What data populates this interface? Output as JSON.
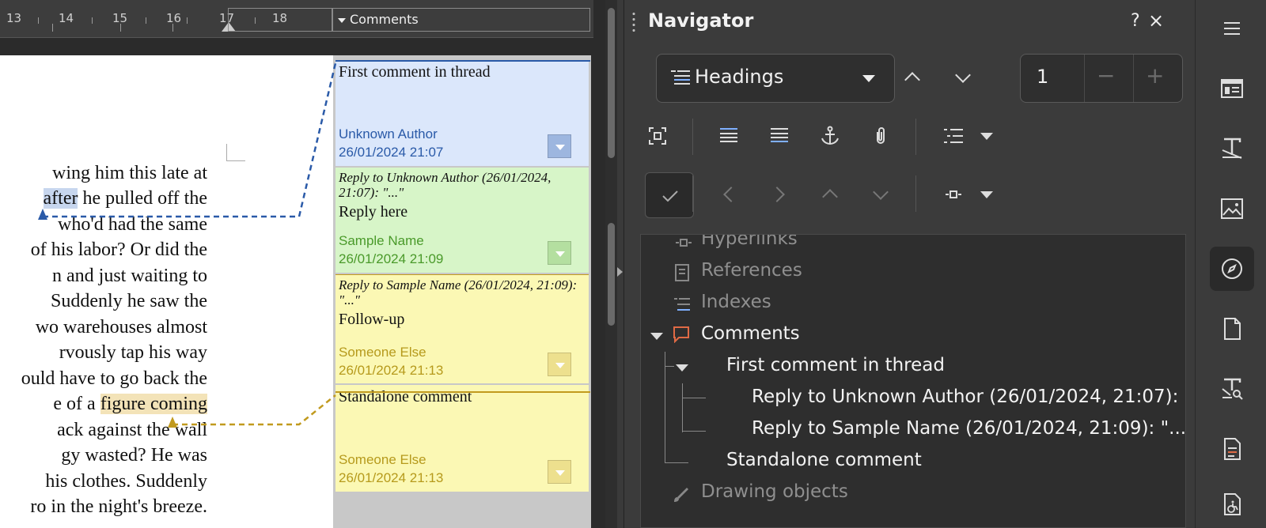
{
  "ruler": {
    "numbers": [
      "13",
      "14",
      "15",
      "16",
      "17",
      "18"
    ],
    "comments_label": "Comments"
  },
  "document": {
    "lines": [
      {
        "pre": "wing him this late at",
        "hl": "",
        "post": ""
      },
      {
        "pre": "",
        "hl": "after",
        "post": " he pulled off the",
        "hl_color": "blue"
      },
      {
        "pre": "who'd had the same",
        "hl": "",
        "post": ""
      },
      {
        "pre": "of his labor? Or did the",
        "hl": "",
        "post": ""
      },
      {
        "pre": "n and just waiting to",
        "hl": "",
        "post": ""
      },
      {
        "pre": " Suddenly he saw the",
        "hl": "",
        "post": ""
      },
      {
        "pre": "wo warehouses almost",
        "hl": "",
        "post": ""
      },
      {
        "pre": "rvously tap his way",
        "hl": "",
        "post": ""
      },
      {
        "pre": "ould have to go back the",
        "hl": "",
        "post": ""
      },
      {
        "pre": "e of a ",
        "hl": "figure coming",
        "post": "",
        "hl_color": "gold"
      },
      {
        "pre": "ack against the wall",
        "hl": "",
        "post": ""
      },
      {
        "pre": "gy wasted? He was",
        "hl": "",
        "post": ""
      },
      {
        "pre": "his clothes. Suddenly",
        "hl": "",
        "post": ""
      },
      {
        "pre": "ro in the night's breeze.",
        "hl": "",
        "post": ""
      }
    ]
  },
  "comments": [
    {
      "body": "First comment in thread",
      "quote": "",
      "author": "Unknown Author",
      "date": "26/01/2024 21:07",
      "bg": "#dbe7fb",
      "text_color": "#2a5aa8",
      "btn": "#9db6df"
    },
    {
      "quote": "Reply to Unknown Author (26/01/2024, 21:07): \"...\"",
      "body": "Reply here",
      "author": "Sample Name",
      "date": "26/01/2024 21:09",
      "bg": "#d7f5c8",
      "text_color": "#4a9a2a",
      "btn": "#b4dfa0"
    },
    {
      "quote": "Reply to Sample Name (26/01/2024, 21:09): \"...\"",
      "body": "Follow-up",
      "author": "Someone Else",
      "date": "26/01/2024 21:13",
      "bg": "#fbf8b4",
      "text_color": "#b69a1c",
      "btn": "#ede08e"
    },
    {
      "body": "Standalone comment",
      "quote": "",
      "author": "Someone Else",
      "date": "26/01/2024 21:13",
      "bg": "#fbf8b4",
      "text_color": "#b69a1c",
      "btn": "#ede08e"
    }
  ],
  "navigator": {
    "title": "Navigator",
    "help": "?",
    "close": "×",
    "category": "Headings",
    "level": "1",
    "minus": "−",
    "plus": "+",
    "tree": [
      {
        "label": "Hyperlinks",
        "state": "dim",
        "icon": "hyperlink-icon"
      },
      {
        "label": "References",
        "state": "dim",
        "icon": "references-icon"
      },
      {
        "label": "Indexes",
        "state": "dim",
        "icon": "indexes-icon"
      },
      {
        "label": "Comments",
        "state": "bright",
        "icon": "comment-icon"
      },
      {
        "label": "First comment in thread",
        "state": "bright"
      },
      {
        "label": "Reply to Unknown Author (26/01/2024, 21:07):",
        "state": "bright"
      },
      {
        "label": "Reply to Sample Name (26/01/2024, 21:09): \"...",
        "state": "bright"
      },
      {
        "label": "Standalone comment",
        "state": "bright"
      },
      {
        "label": "Drawing objects",
        "state": "dim",
        "icon": "drawing-icon"
      }
    ]
  }
}
